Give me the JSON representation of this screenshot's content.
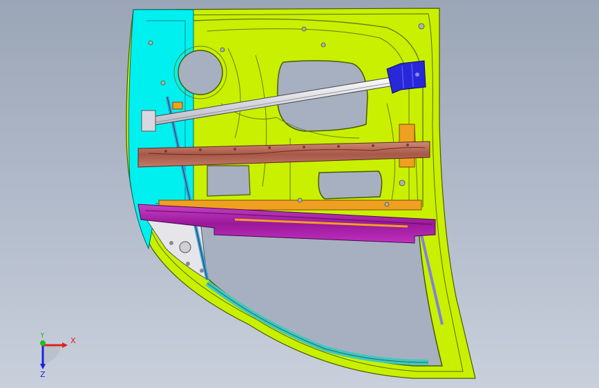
{
  "viewport": {
    "background_top": "#9aa5b6",
    "background_bottom": "#c9d0dc"
  },
  "model": {
    "parts": [
      {
        "name": "outer-panel",
        "color": "#c8f000"
      },
      {
        "name": "hinge-pillar",
        "color": "#00f0f0"
      },
      {
        "name": "window-regulator-rail",
        "color": "#e8e8ee"
      },
      {
        "name": "upper-reinforcement-beam",
        "color": "#b06050"
      },
      {
        "name": "lower-impact-beam",
        "color": "#b020b0"
      },
      {
        "name": "mounting-bracket",
        "color": "#2828d8"
      },
      {
        "name": "orange-brackets",
        "color": "#f0a020"
      },
      {
        "name": "glass-run-channel",
        "color": "#40c8c0"
      }
    ]
  },
  "triad": {
    "x_label": "X",
    "y_label": "Y",
    "z_label": "Z",
    "x_color": "#e02020",
    "y_color": "#20c020",
    "z_color": "#2020e0"
  }
}
